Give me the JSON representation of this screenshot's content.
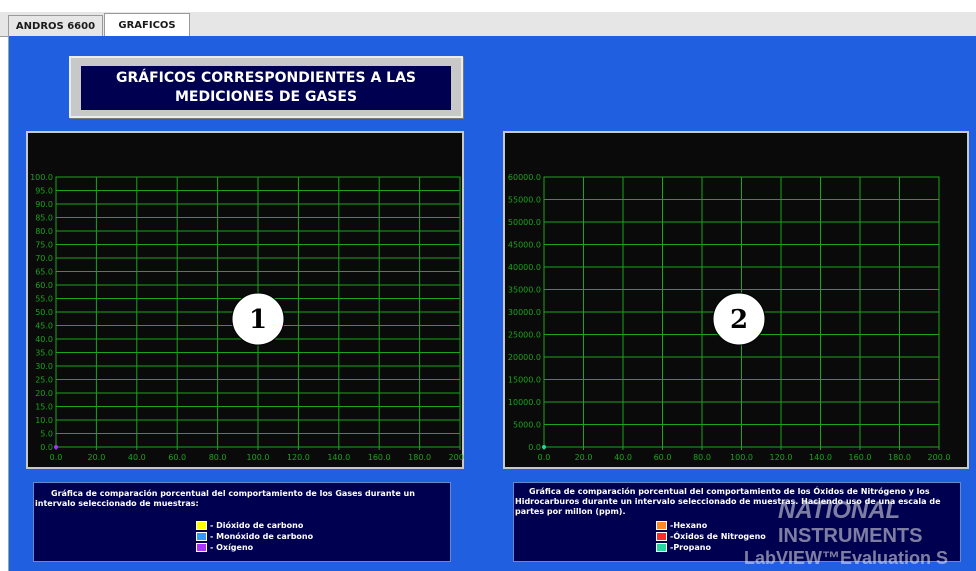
{
  "tabs": [
    {
      "label": "ANDROS 6600",
      "active": false
    },
    {
      "label": "GRAFICOS",
      "active": true
    }
  ],
  "panel": {
    "title": "GRÁFICOS CORRESPONDIENTES A LAS MEDICIONES DE GASES",
    "background_color": "#1f5fe0"
  },
  "chart_data": [
    {
      "type": "line",
      "marker_label": "1",
      "xlim": [
        0,
        200
      ],
      "ylim": [
        0,
        100
      ],
      "x_ticks": [
        "0.0",
        "20.0",
        "40.0",
        "60.0",
        "80.0",
        "100.0",
        "120.0",
        "140.0",
        "160.0",
        "180.0",
        "200.0"
      ],
      "y_ticks": [
        "0.0",
        "5.0",
        "10.0",
        "15.0",
        "20.0",
        "25.0",
        "30.0",
        "35.0",
        "40.0",
        "45.0",
        "50.0",
        "55.0",
        "60.0",
        "65.0",
        "70.0",
        "75.0",
        "80.0",
        "85.0",
        "90.0",
        "95.0",
        "100.0"
      ],
      "grid": true,
      "grid_color": "#1aa51a",
      "series": [
        {
          "name": "Dióxido de carbono",
          "color": "#ffff00",
          "values": []
        },
        {
          "name": "Monóxido de carbono",
          "color": "#3399ff",
          "values": []
        },
        {
          "name": "Oxígeno",
          "color": "#aa33ff",
          "values": []
        }
      ]
    },
    {
      "type": "line",
      "marker_label": "2",
      "xlim": [
        0,
        200
      ],
      "ylim": [
        0,
        60000
      ],
      "x_ticks": [
        "0.0",
        "20.0",
        "40.0",
        "60.0",
        "80.0",
        "100.0",
        "120.0",
        "140.0",
        "160.0",
        "180.0",
        "200.0"
      ],
      "y_ticks": [
        "0.0",
        "5000.0",
        "10000.0",
        "15000.0",
        "20000.0",
        "25000.0",
        "30000.0",
        "35000.0",
        "40000.0",
        "45000.0",
        "50000.0",
        "55000.0",
        "60000.0"
      ],
      "grid": true,
      "grid_color": "#1aa51a",
      "series": [
        {
          "name": "Hexano",
          "color": "#ff8a1e",
          "values": []
        },
        {
          "name": "Óxidos de Nitrogeno",
          "color": "#ff2a2a",
          "values": []
        },
        {
          "name": "Propano",
          "color": "#22d8a0",
          "values": []
        }
      ]
    }
  ],
  "legend1": {
    "description": "Gráfica de comparación porcentual del comportamiento de los Gases durante un intervalo seleccionado de muestras:",
    "items": [
      {
        "label": "- Dióxido de carbono",
        "color": "#ffff00"
      },
      {
        "label": "- Monóxido de carbono",
        "color": "#3399ff"
      },
      {
        "label": "- Oxígeno",
        "color": "#aa33ff"
      }
    ]
  },
  "legend2": {
    "description": "Gráfica de comparación porcentual del comportamiento de los    Óxidos de Nitrógeno y los Hidrocarburos durante un intervalo seleccionado de muestras. Haciendo uso de una escala de partes por millon (ppm).",
    "items": [
      {
        "label": "-Hexano",
        "color": "#ff8a1e"
      },
      {
        "label": "-Óxidos de Nitrogeno",
        "color": "#ff2a2a"
      },
      {
        "label": "-Propano",
        "color": "#22d8a0"
      }
    ]
  },
  "watermark": {
    "line1": "NATIONAL",
    "line2": "INSTRUMENTS",
    "line3": "LabVIEW™Evaluation S"
  }
}
